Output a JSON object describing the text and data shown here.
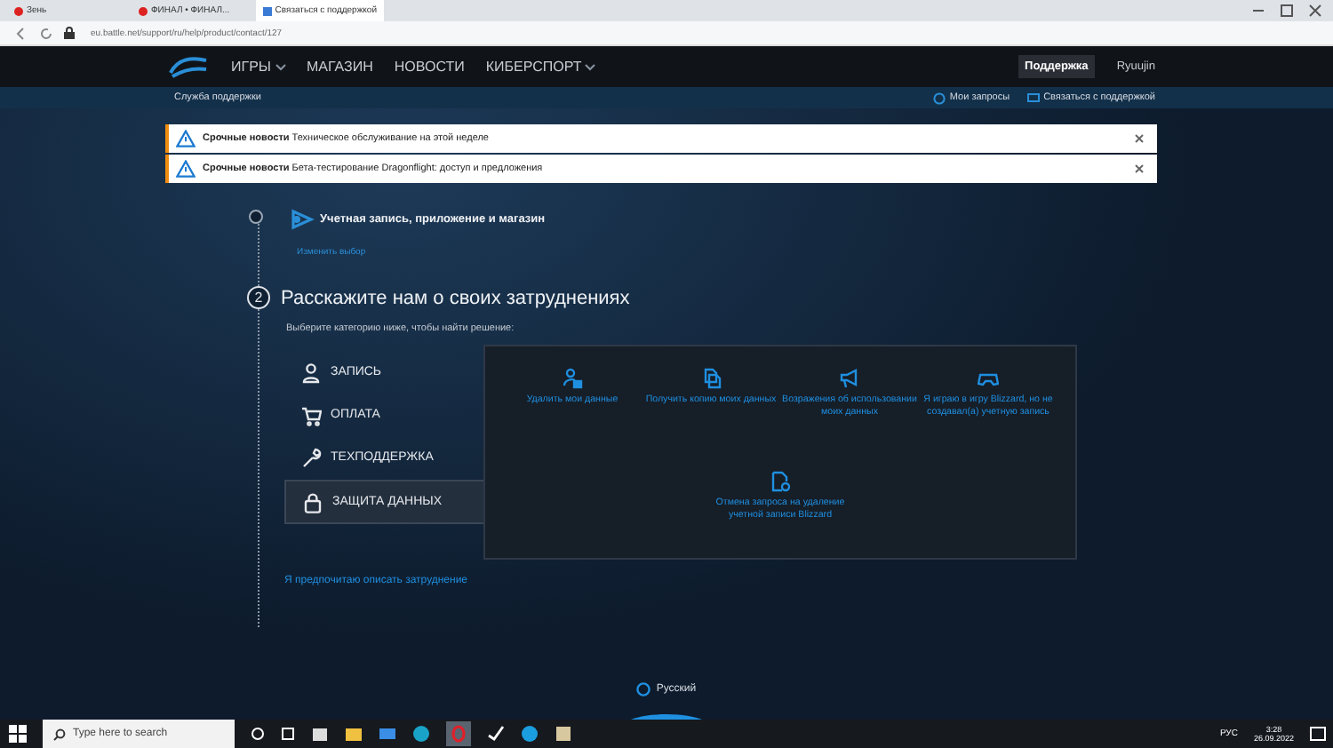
{
  "browser": {
    "tabs": [
      {
        "label": "Зень",
        "selected": false
      },
      {
        "label": "ФИНАЛ • ФИНАЛ...",
        "selected": false
      },
      {
        "label": "Связаться с поддержкой",
        "selected": true
      }
    ],
    "address": "eu.battle.net/support/ru/help/product/contact/127"
  },
  "site_nav": {
    "links": [
      {
        "label": "ИГРЫ",
        "dropdown": true
      },
      {
        "label": "МАГАЗИН",
        "dropdown": false
      },
      {
        "label": "НОВОСТИ",
        "dropdown": false
      },
      {
        "label": "КИБЕРСПОРТ",
        "dropdown": true
      }
    ],
    "support": "Поддержка",
    "user": "Ryuujin"
  },
  "subnav": {
    "home": "Служба поддержки",
    "links": [
      {
        "label": "Мои запросы",
        "kind": "requests"
      },
      {
        "label": "Связаться с поддержкой",
        "kind": "contact"
      }
    ]
  },
  "alerts": [
    {
      "title": "Срочные новости",
      "text": "Техническое обслуживание на этой неделе"
    },
    {
      "title": "Срочные новости",
      "text": "Бета-тестирование Dragonflight: доступ и предложения"
    }
  ],
  "step1": {
    "title": "Учетная запись, приложение и магазин",
    "change": "Изменить выбор"
  },
  "step2": {
    "number": "2",
    "title": "Расскажите нам о своих затруднениях",
    "prompt": "Выберите категорию ниже, чтобы найти решение:"
  },
  "categories": [
    {
      "label": "ЗАПИСЬ",
      "kind": "account",
      "selected": false
    },
    {
      "label": "ОПЛАТА",
      "kind": "cart",
      "selected": false
    },
    {
      "label": "ТЕХПОДДЕРЖКА",
      "kind": "wrench",
      "selected": false
    },
    {
      "label": "ЗАЩИТА ДАННЫХ",
      "kind": "lock",
      "selected": true
    }
  ],
  "options": [
    {
      "label": "Удалить мои данные",
      "kind": "user-delete"
    },
    {
      "label": "Получить копию моих данных",
      "kind": "copy"
    },
    {
      "label": "Возражения об использовании моих данных",
      "kind": "megaphone"
    },
    {
      "label": "Я играю в игру Blizzard, но не создавал(а) учетную запись",
      "kind": "gamepad"
    },
    {
      "label": "Отмена запроса на удаление учетной записи Blizzard",
      "kind": "file-cancel"
    }
  ],
  "describe_link": "Я предпочитаю описать затруднение",
  "footer": {
    "language": "Русский"
  },
  "taskbar": {
    "search_placeholder": "Type here to search",
    "language": "РУС",
    "time": "3:28",
    "date": "26.09.2022"
  }
}
